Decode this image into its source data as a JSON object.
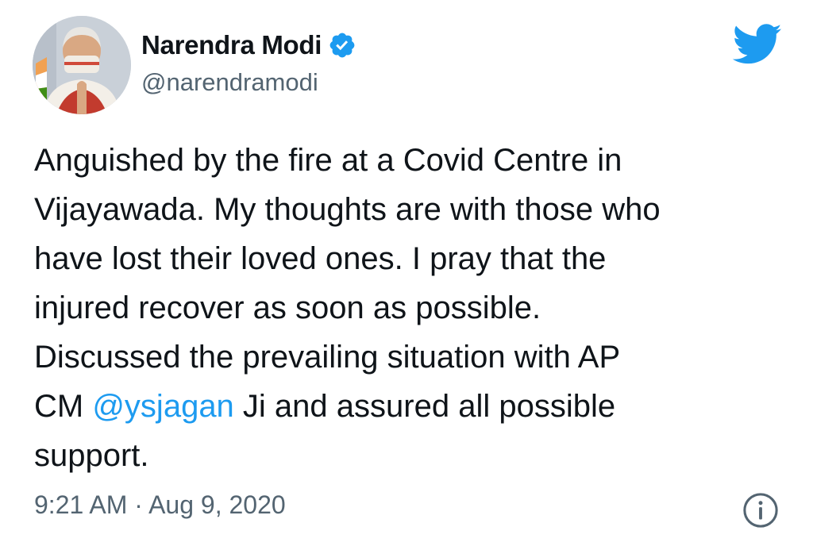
{
  "author": {
    "display_name": "Narendra Modi",
    "handle": "@narendramodi",
    "verified": true,
    "avatar_icon": "profile-photo"
  },
  "tweet": {
    "line1": "Anguished by the fire at a Covid Centre in",
    "line2": "Vijayawada. My thoughts are with those who",
    "line3": "have lost their loved ones. I pray that the",
    "line4": "injured recover as soon as possible.",
    "line5": "Discussed the prevailing situation with AP",
    "line6_prefix": "CM ",
    "mention": "@ysjagan",
    "line6_suffix": " Ji and assured all possible",
    "line7": "support."
  },
  "meta": {
    "timestamp": "9:21 AM · Aug 9, 2020"
  },
  "icons": {
    "brand": "twitter-bird-icon",
    "verified": "verified-badge-icon",
    "info": "info-icon"
  },
  "colors": {
    "accent": "#1d9bf0",
    "text": "#0f1419",
    "secondary": "#536471"
  }
}
